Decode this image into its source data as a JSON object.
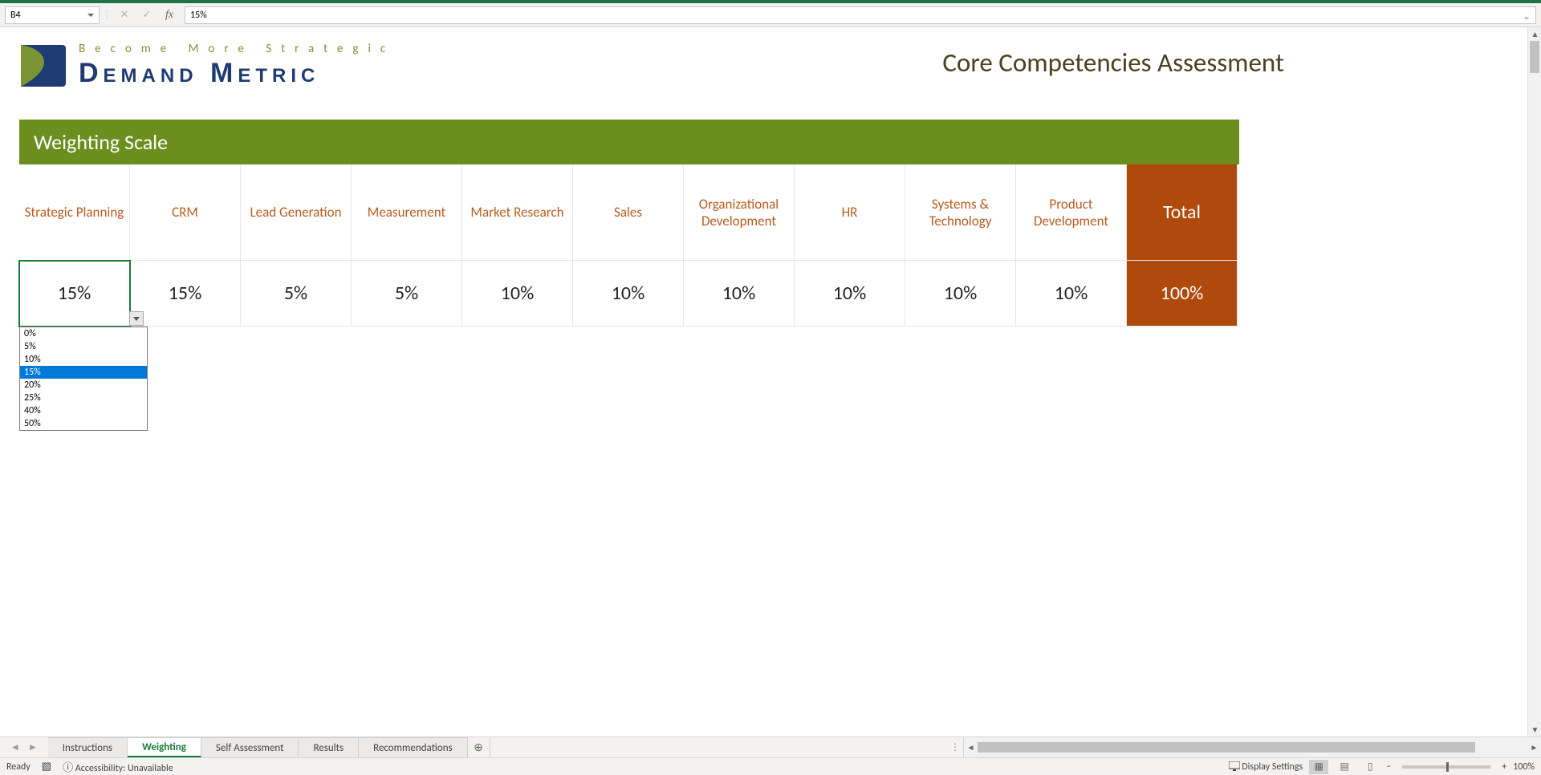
{
  "name_box": "B4",
  "formula_value": "15%",
  "logo": {
    "tagline": "Become More Strategic",
    "brand": "Demand Metric"
  },
  "doc_title": "Core Competencies Assessment",
  "section_title": "Weighting Scale",
  "columns": [
    "Strategic Planning",
    "CRM",
    "Lead Generation",
    "Measurement",
    "Market Research",
    "Sales",
    "Organizational Development",
    "HR",
    "Systems & Technology",
    "Product Development"
  ],
  "total_label": "Total",
  "values": [
    "15%",
    "15%",
    "5%",
    "5%",
    "10%",
    "10%",
    "10%",
    "10%",
    "10%",
    "10%"
  ],
  "total_value": "100%",
  "dropdown_options": [
    "0%",
    "5%",
    "10%",
    "15%",
    "20%",
    "25%",
    "40%",
    "50%"
  ],
  "dropdown_selected": "15%",
  "sheet_tabs": [
    "Instructions",
    "Weighting",
    "Self Assessment",
    "Results",
    "Recommendations"
  ],
  "active_tab": "Weighting",
  "status": {
    "ready": "Ready",
    "accessibility": "Accessibility: Unavailable",
    "display_settings": "Display Settings",
    "zoom": "100%"
  }
}
